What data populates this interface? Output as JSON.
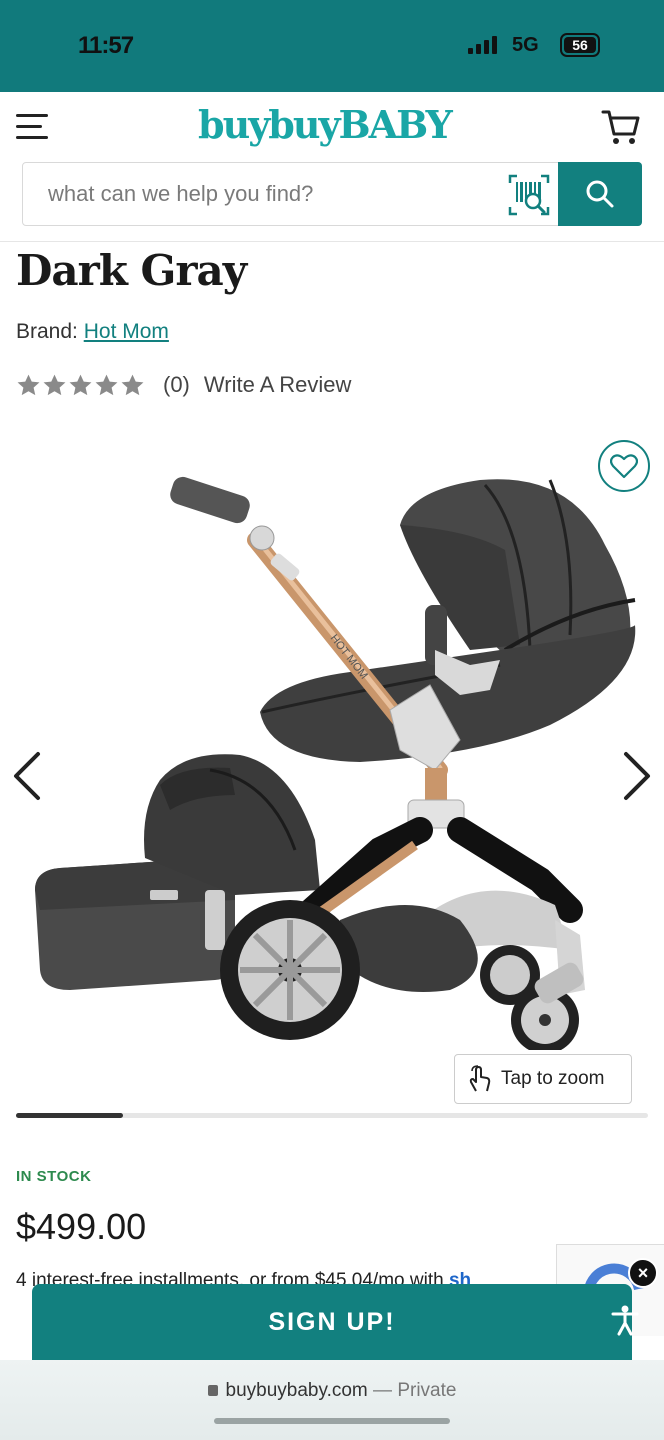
{
  "status_bar": {
    "time": "11:57",
    "network": "5G",
    "battery": "56"
  },
  "header": {
    "logo": "buybuyBABY",
    "search_placeholder": "what can we help you find?"
  },
  "product": {
    "title_visible": "Dark Gray",
    "brand_label": "Brand:",
    "brand_name": "Hot Mom",
    "rating_count": "(0)",
    "write_review": "Write A Review",
    "stars_filled": 0,
    "stars_total": 5,
    "stroller_logo_text": "HOT MOM",
    "zoom_label": "Tap to zoom",
    "gallery_progress": 0.17,
    "stock_status": "IN STOCK",
    "price": "$499.00",
    "installments_prefix": "4 interest-free installments, or from $45.04/mo with",
    "installments_link": "sh"
  },
  "signup": {
    "label": "SIGN UP!"
  },
  "browser": {
    "url": "buybuybaby.com",
    "mode": "— Private"
  },
  "colors": {
    "brand_teal": "#12807f",
    "status_teal": "#117a7c",
    "logo_teal": "#1aa6a6",
    "in_stock_green": "#2d8a4e",
    "star_gray": "#8a8a8a"
  },
  "icons": {
    "menu": "hamburger-icon",
    "cart": "cart-icon",
    "barcode": "barcode-scan-icon",
    "search": "search-icon",
    "wishlist": "heart-icon",
    "prev": "chevron-left-icon",
    "next": "chevron-right-icon",
    "zoom": "tap-hand-icon",
    "close": "close-icon",
    "accessibility": "accessibility-icon",
    "lock": "lock-icon"
  }
}
